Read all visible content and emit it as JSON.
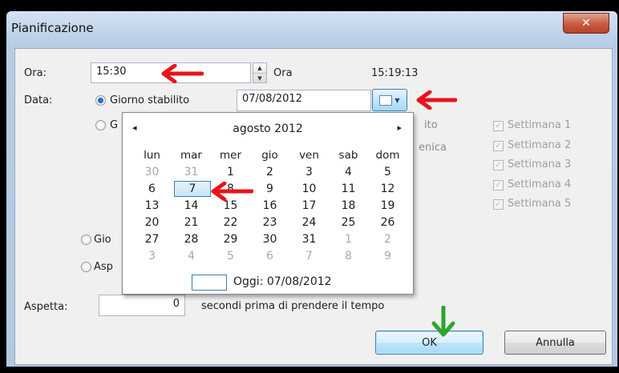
{
  "window": {
    "title": "Pianificazione",
    "close_glyph": "✕"
  },
  "ora": {
    "label": "Ora:",
    "value": "15:30",
    "unit_label": "Ora",
    "current_time": "15:19:13"
  },
  "data": {
    "label": "Data:",
    "option_fixed_day": "Giorno stabilito",
    "date_value": "07/08/2012",
    "option_partial": "G",
    "behind_text_1": "ito",
    "behind_text_2": "enica"
  },
  "weeks": [
    {
      "label": "Settimana 1",
      "checked": true
    },
    {
      "label": "Settimana 2",
      "checked": true
    },
    {
      "label": "Settimana 3",
      "checked": true
    },
    {
      "label": "Settimana 4",
      "checked": true
    },
    {
      "label": "Settimana 5",
      "checked": true
    }
  ],
  "radio_gio": "Gio",
  "radio_asp": "Asp",
  "calendar": {
    "prev_glyph": "◂",
    "next_glyph": "▸",
    "month_title": "agosto 2012",
    "day_headers": [
      "lun",
      "mar",
      "mer",
      "gio",
      "ven",
      "sab",
      "dom"
    ],
    "weeks": [
      [
        "30",
        "31",
        "1",
        "2",
        "3",
        "4",
        "5"
      ],
      [
        "6",
        "7",
        "8",
        "9",
        "10",
        "11",
        "12"
      ],
      [
        "13",
        "14",
        "15",
        "16",
        "17",
        "18",
        "19"
      ],
      [
        "20",
        "21",
        "22",
        "23",
        "24",
        "25",
        "26"
      ],
      [
        "27",
        "28",
        "29",
        "30",
        "31",
        "1",
        "2"
      ],
      [
        "3",
        "4",
        "5",
        "6",
        "7",
        "8",
        "9"
      ]
    ],
    "selected_day": "7",
    "today_label": "Oggi: 07/08/2012"
  },
  "aspetta": {
    "label": "Aspetta:",
    "value": "0",
    "suffix": "secondi prima di prendere il tempo"
  },
  "buttons": {
    "ok": "OK",
    "cancel": "Annulla"
  },
  "colors": {
    "annotation_red": "#e8141b",
    "annotation_green": "#2fa52b",
    "selection_blue": "#3c7fb1"
  },
  "icons": {
    "calendar": "calendar-icon",
    "spinner": "up-down-spinner-icon",
    "close": "close-icon"
  }
}
